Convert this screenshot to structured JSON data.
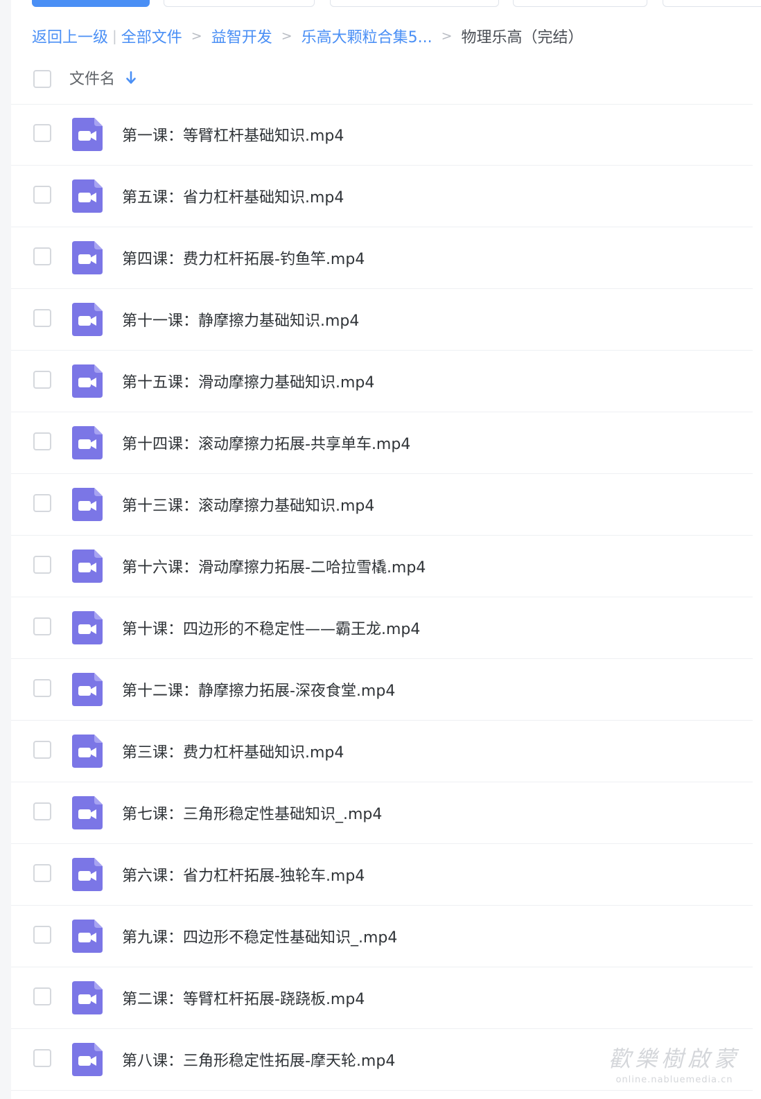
{
  "breadcrumb": {
    "back": "返回上一级",
    "all_files": "全部文件",
    "items": [
      "益智开发",
      "乐高大颗粒合集5..."
    ],
    "current": "物理乐高（完结）"
  },
  "list": {
    "header_name": "文件名",
    "files": [
      "第一课：等臂杠杆基础知识.mp4",
      "第五课：省力杠杆基础知识.mp4",
      "第四课：费力杠杆拓展-钓鱼竿.mp4",
      "第十一课：静摩擦力基础知识.mp4",
      "第十五课：滑动摩擦力基础知识.mp4",
      "第十四课：滚动摩擦力拓展-共享单车.mp4",
      "第十三课：滚动摩擦力基础知识.mp4",
      "第十六课：滑动摩擦力拓展-二哈拉雪橇.mp4",
      "第十课：四边形的不稳定性——霸王龙.mp4",
      "第十二课：静摩擦力拓展-深夜食堂.mp4",
      "第三课：费力杠杆基础知识.mp4",
      "第七课：三角形稳定性基础知识_.mp4",
      "第六课：省力杠杆拓展-独轮车.mp4",
      "第九课：四边形不稳定性基础知识_.mp4",
      "第二课：等臂杠杆拓展-跷跷板.mp4",
      "第八课：三角形稳定性拓展-摩天轮.mp4"
    ]
  },
  "watermark": {
    "main": "歡樂樹啟蒙",
    "sub": "online.nabluemedia.cn"
  },
  "colors": {
    "accent": "#4a8ff5",
    "video_icon": "#7b76e6"
  },
  "icons": {
    "file": "video-file-icon",
    "sort": "arrow-down-icon"
  }
}
